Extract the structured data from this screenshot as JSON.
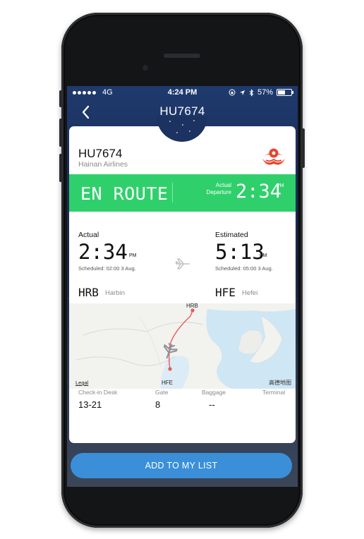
{
  "status_bar": {
    "carrier": "4G",
    "time": "4:24 PM",
    "battery": "57%",
    "battery_level": 0.57
  },
  "nav": {
    "title": "HU7674"
  },
  "flight": {
    "number": "HU7674",
    "airline": "Hainan Airlines"
  },
  "status": {
    "label": "EN ROUTE",
    "dep_label_line1": "Actual",
    "dep_label_line2": "Departure",
    "dep_time": "2:34",
    "dep_pm": "PM"
  },
  "times": {
    "actual": {
      "label": "Actual",
      "time": "2:34",
      "ampm": "PM",
      "scheduled": "Scheduled: 02:00 3 Aug."
    },
    "estimated": {
      "label": "Estimated",
      "time": "5:13",
      "ampm": "PM",
      "scheduled": "Scheduled: 05:00 3 Aug."
    }
  },
  "route": {
    "origin": {
      "code": "HRB",
      "city": "Harbin"
    },
    "destination": {
      "code": "HFE",
      "city": "Hefei"
    }
  },
  "map": {
    "origin_label": "HRB",
    "destination_label": "HFE",
    "legal": "Legal",
    "attribution": "高德地图"
  },
  "info": {
    "checkin_label": "Check-in Desk",
    "checkin_value": "13-21",
    "gate_label": "Gate",
    "gate_value": "8",
    "baggage_label": "Baggage",
    "baggage_value": "--",
    "terminal_label": "Terminal",
    "terminal_value": ""
  },
  "actions": {
    "add_label": "ADD TO MY LIST"
  },
  "colors": {
    "status_green": "#2fd06b",
    "button_blue": "#3a8fd8",
    "route_red": "#e85a5a",
    "nav_blue": "#1f3a6e"
  }
}
